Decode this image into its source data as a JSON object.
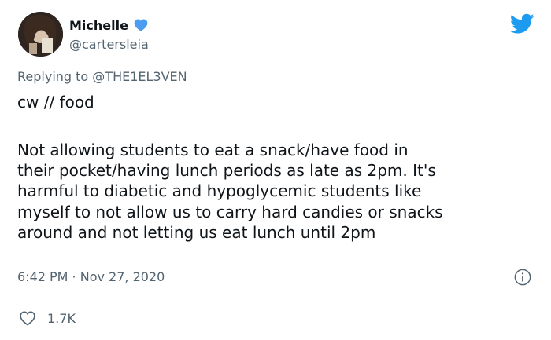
{
  "tweet": {
    "author": {
      "display_name": "Michelle",
      "handle": "@cartersleia",
      "verified_icon": "heart-verified-icon"
    },
    "replying_label": "Replying to",
    "replying_to": "@THE1EL3VEN",
    "content_warning": "cw // food",
    "body_lines": [
      "Not allowing students to eat a snack/have food in",
      "their pocket/having lunch periods as late as 2pm. It's",
      "harmful to diabetic and hypoglycemic students like",
      "myself to not allow us to carry hard candies or snacks",
      "around and not letting us eat lunch until 2pm"
    ],
    "timestamp": "6:42 PM · Nov 27, 2020",
    "like_count": "1.7K"
  },
  "colors": {
    "twitter_blue": "#1d9bf0",
    "muted_text": "#536471",
    "verified_heart": "#4a9df0"
  }
}
